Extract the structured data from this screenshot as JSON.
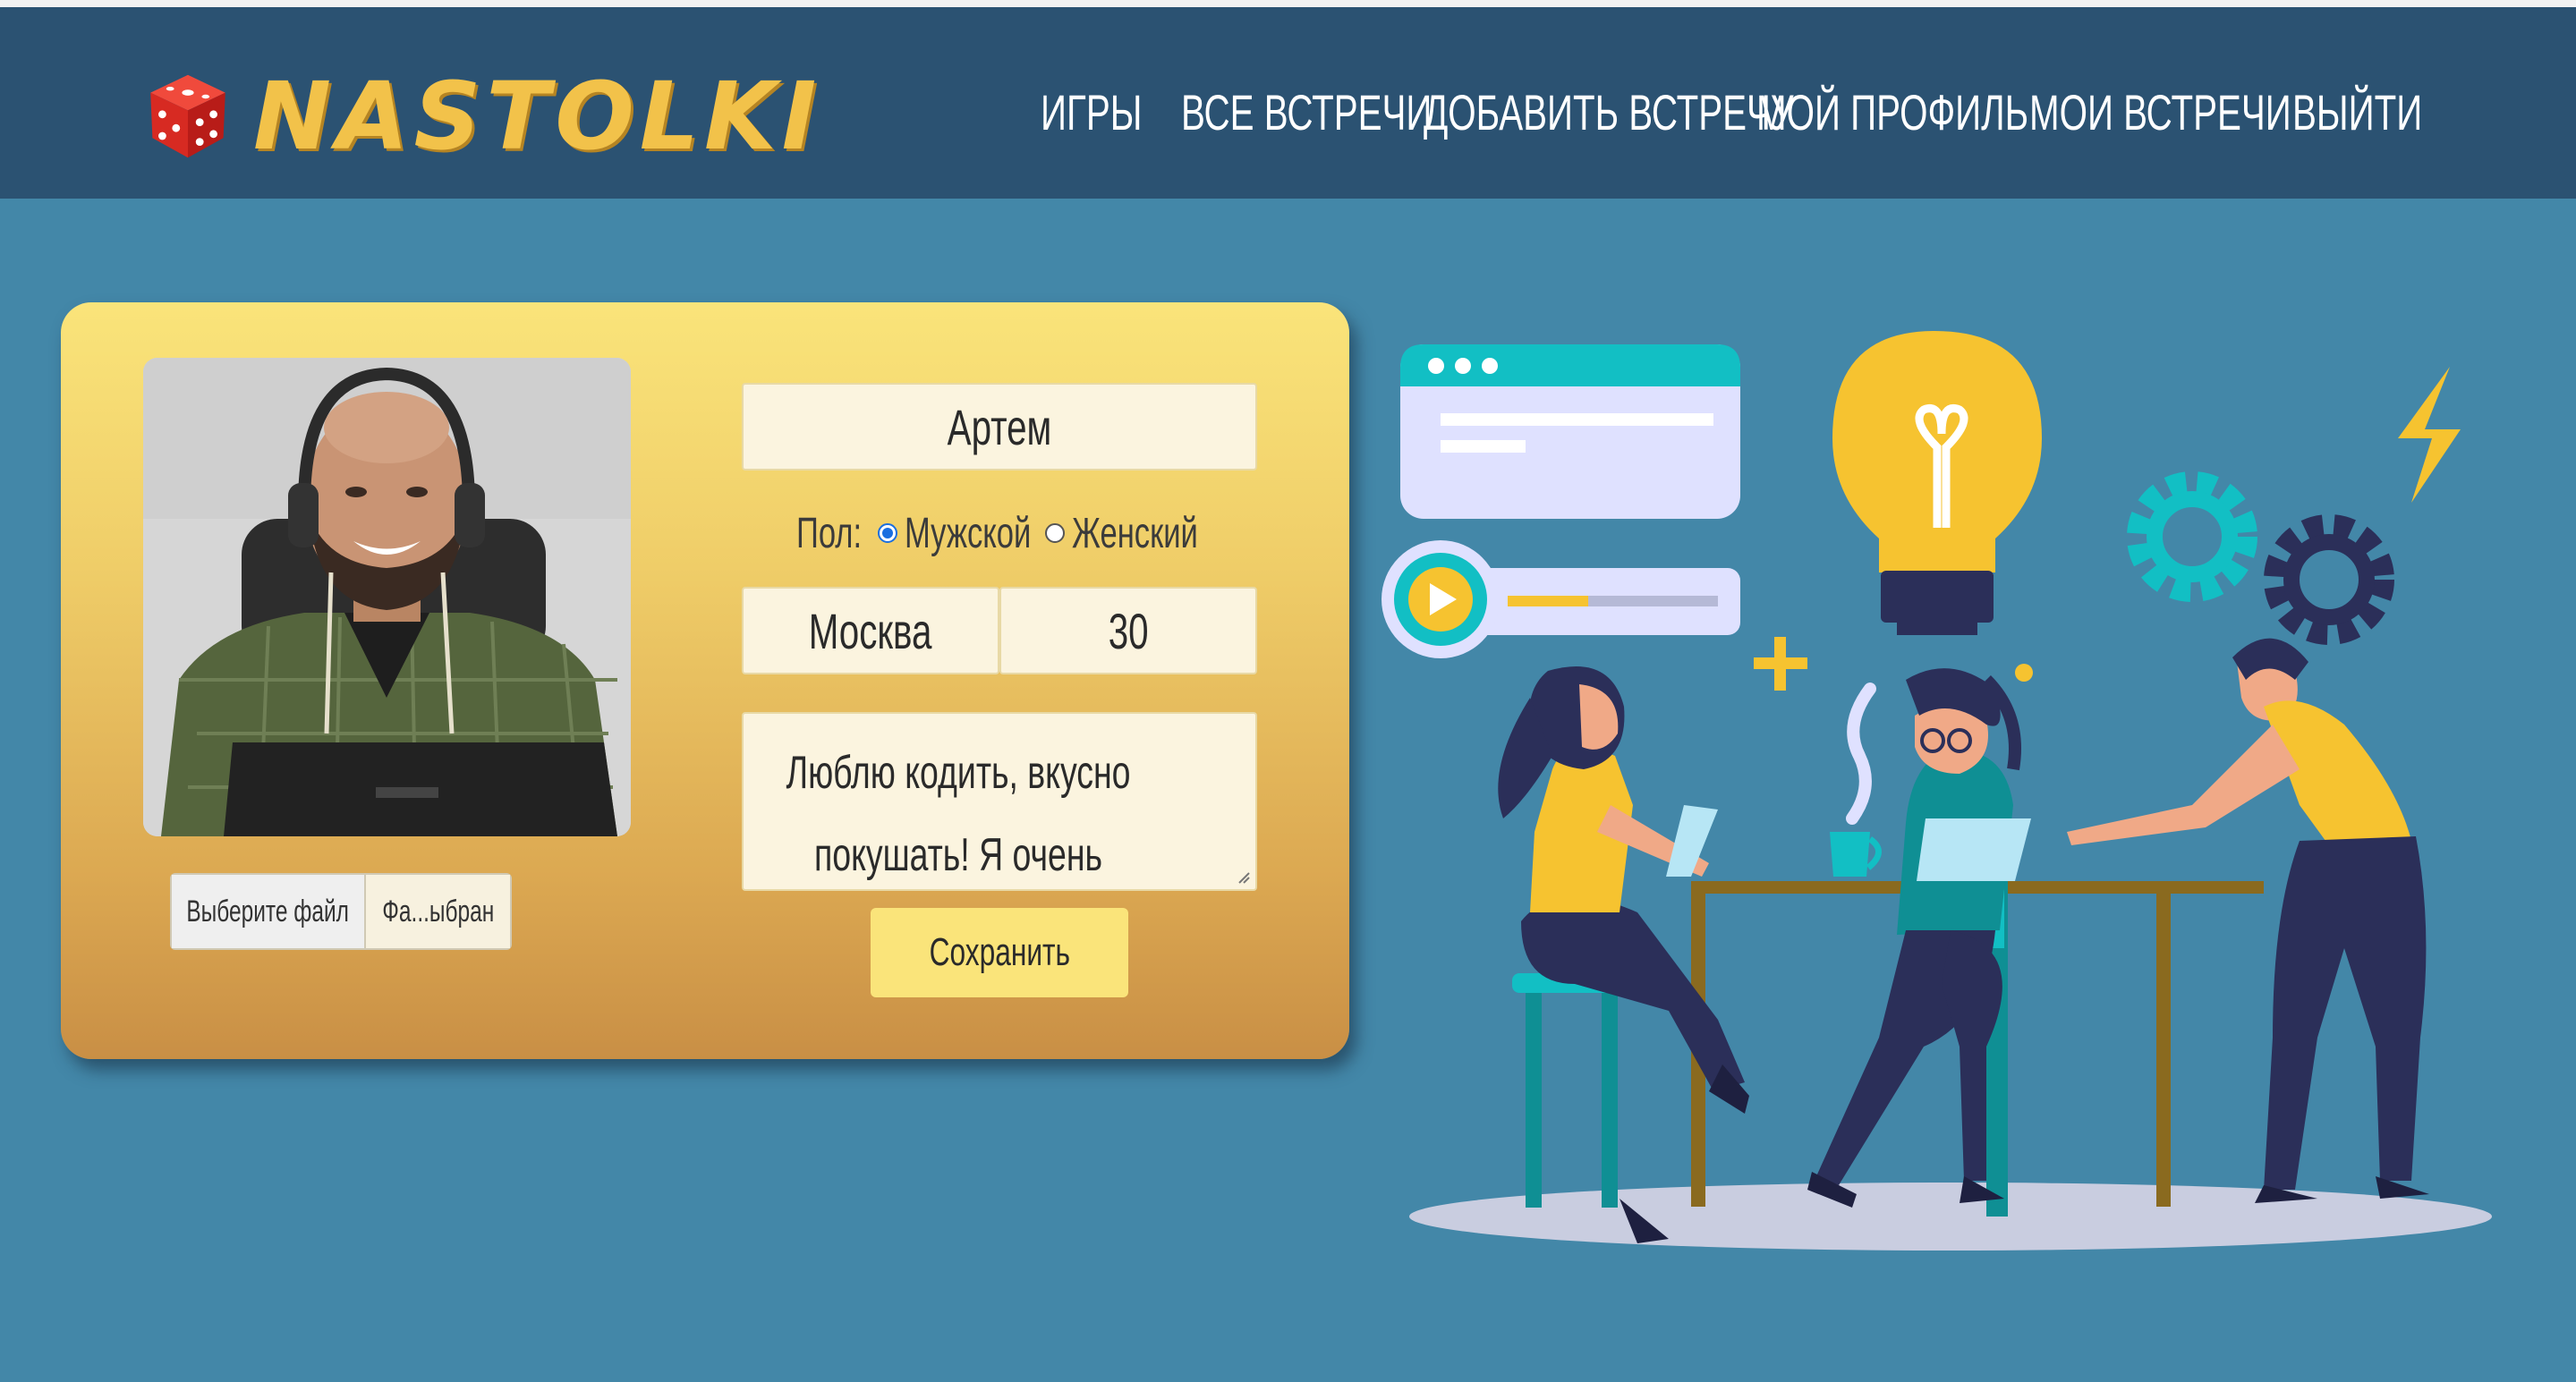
{
  "brand": {
    "name": "NASTOLKI",
    "logo_icon": "dice-icon"
  },
  "nav": {
    "items": [
      "Игры",
      "Все встречи",
      "Добавить встречу",
      "Мой профиль",
      "Мои встречи",
      "Выйти"
    ]
  },
  "profile": {
    "name": "Артем",
    "gender_label": "Пол:",
    "gender_options": [
      "Мужской",
      "Женский"
    ],
    "gender_selected": "Мужской",
    "city": "Москва",
    "age": "30",
    "bio": "Люблю кодить, вкусно покушать! Я очень",
    "file_button": "Выберите файл",
    "file_name": "Фа...ыбран",
    "save_label": "Сохранить"
  },
  "colors": {
    "background": "#4387a8",
    "header": "#2b5272",
    "brand_gold": "#f2c24a",
    "card_top": "#fae47a",
    "card_bottom": "#c98f45",
    "accent_yellow": "#f6c330",
    "accent_teal": "#1bbcc0",
    "radio_selected": "#1a6fe0"
  },
  "illustration": {
    "icons": [
      "browser-window-icon",
      "video-player-icon",
      "lightbulb-icon",
      "lightning-icon",
      "gear-icon",
      "plus-icon"
    ]
  }
}
